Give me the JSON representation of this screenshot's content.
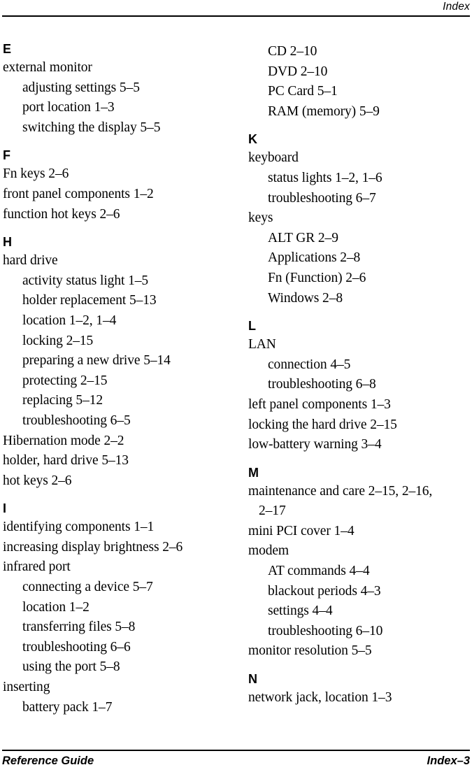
{
  "header": {
    "title": "Index"
  },
  "footer": {
    "left": "Reference Guide",
    "right": "Index–3"
  },
  "columns": [
    {
      "id": "left",
      "blocks": [
        {
          "letter": "E",
          "first": true,
          "entries": [
            {
              "level": 1,
              "text": "external monitor"
            },
            {
              "level": 2,
              "text": "adjusting settings 5–5"
            },
            {
              "level": 2,
              "text": "port location 1–3"
            },
            {
              "level": 2,
              "text": "switching the display 5–5"
            }
          ]
        },
        {
          "letter": "F",
          "first": false,
          "entries": [
            {
              "level": 1,
              "text": "Fn keys 2–6"
            },
            {
              "level": 1,
              "text": "front panel components 1–2"
            },
            {
              "level": 1,
              "text": "function hot keys 2–6"
            }
          ]
        },
        {
          "letter": "H",
          "first": false,
          "entries": [
            {
              "level": 1,
              "text": "hard drive"
            },
            {
              "level": 2,
              "text": "activity status light 1–5"
            },
            {
              "level": 2,
              "text": "holder replacement 5–13"
            },
            {
              "level": 2,
              "text": "location 1–2, 1–4"
            },
            {
              "level": 2,
              "text": "locking 2–15"
            },
            {
              "level": 2,
              "text": "preparing a new drive 5–14"
            },
            {
              "level": 2,
              "text": "protecting 2–15"
            },
            {
              "level": 2,
              "text": "replacing 5–12"
            },
            {
              "level": 2,
              "text": "troubleshooting 6–5"
            },
            {
              "level": 1,
              "text": "Hibernation mode 2–2"
            },
            {
              "level": 1,
              "text": "holder, hard drive 5–13"
            },
            {
              "level": 1,
              "text": "hot keys 2–6"
            }
          ]
        },
        {
          "letter": "I",
          "first": false,
          "entries": [
            {
              "level": 1,
              "text": "identifying components 1–1"
            },
            {
              "level": 1,
              "text": "increasing display brightness 2–6"
            },
            {
              "level": 1,
              "text": "infrared port"
            },
            {
              "level": 2,
              "text": "connecting a device 5–7"
            },
            {
              "level": 2,
              "text": "location 1–2"
            },
            {
              "level": 2,
              "text": "transferring files 5–8"
            },
            {
              "level": 2,
              "text": "troubleshooting 6–6"
            },
            {
              "level": 2,
              "text": "using the port 5–8"
            },
            {
              "level": 1,
              "text": "inserting"
            },
            {
              "level": 2,
              "text": "battery pack 1–7"
            }
          ]
        }
      ]
    },
    {
      "id": "right",
      "blocks": [
        {
          "letter": null,
          "first": true,
          "entries": [
            {
              "level": 2,
              "text": "CD 2–10"
            },
            {
              "level": 2,
              "text": "DVD 2–10"
            },
            {
              "level": 2,
              "text": "PC Card 5–1"
            },
            {
              "level": 2,
              "text": "RAM (memory) 5–9"
            }
          ]
        },
        {
          "letter": "K",
          "first": false,
          "entries": [
            {
              "level": 1,
              "text": "keyboard"
            },
            {
              "level": 2,
              "text": "status lights 1–2, 1–6"
            },
            {
              "level": 2,
              "text": "troubleshooting 6–7"
            },
            {
              "level": 1,
              "text": "keys"
            },
            {
              "level": 2,
              "text": "ALT GR 2–9"
            },
            {
              "level": 2,
              "text": "Applications 2–8"
            },
            {
              "level": 2,
              "text": "Fn (Function) 2–6"
            },
            {
              "level": 2,
              "text": "Windows 2–8"
            }
          ]
        },
        {
          "letter": "L",
          "first": false,
          "entries": [
            {
              "level": 1,
              "text": "LAN"
            },
            {
              "level": 2,
              "text": "connection 4–5"
            },
            {
              "level": 2,
              "text": "troubleshooting 6–8"
            },
            {
              "level": 1,
              "text": "left panel components 1–3"
            },
            {
              "level": 1,
              "text": "locking the hard drive 2–15"
            },
            {
              "level": 1,
              "text": "low-battery warning 3–4"
            }
          ]
        },
        {
          "letter": "M",
          "first": false,
          "entries": [
            {
              "level": 1,
              "text": "maintenance and care 2–15, 2–16,"
            },
            {
              "level": 0,
              "text": "2–17"
            },
            {
              "level": 1,
              "text": "mini PCI cover 1–4"
            },
            {
              "level": 1,
              "text": "modem"
            },
            {
              "level": 2,
              "text": "AT commands 4–4"
            },
            {
              "level": 2,
              "text": "blackout periods 4–3"
            },
            {
              "level": 2,
              "text": "settings 4–4"
            },
            {
              "level": 2,
              "text": "troubleshooting 6–10"
            },
            {
              "level": 1,
              "text": "monitor resolution 5–5"
            }
          ]
        },
        {
          "letter": "N",
          "first": false,
          "entries": [
            {
              "level": 1,
              "text": "network jack, location 1–3"
            }
          ]
        }
      ]
    }
  ]
}
